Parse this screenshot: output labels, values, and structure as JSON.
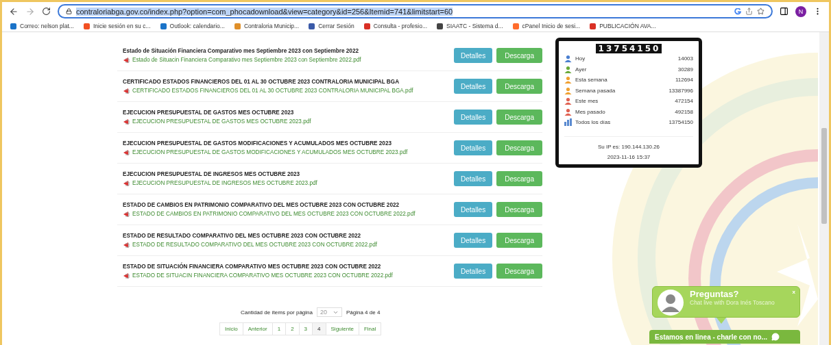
{
  "browser": {
    "url": "contraloriabga.gov.co/index.php?option=com_phocadownload&view=category&id=256&Itemid=741&limitstart=60",
    "profile_initial": "N"
  },
  "bookmarks": [
    {
      "label": "Correo: nelson plat...",
      "color": "#1a73c8"
    },
    {
      "label": "Inicie sesión en su c...",
      "color": "#f25022"
    },
    {
      "label": "Outlook: calendario...",
      "color": "#1a73c8"
    },
    {
      "label": "Contraloria Municip...",
      "color": "#e0902a"
    },
    {
      "label": "Cerrar Sesión",
      "color": "#3a5aa8"
    },
    {
      "label": "Consulta - profesio...",
      "color": "#d93025"
    },
    {
      "label": "SIAATC - Sistema d...",
      "color": "#444444"
    },
    {
      "label": "cPanel Inicio de sesi...",
      "color": "#ff6c2c"
    },
    {
      "label": "PUBLICACIÓN AVA...",
      "color": "#d93025"
    }
  ],
  "documents": [
    {
      "title": "Estado de Situación Financiera Comparativo mes Septiembre 2023 con Septiembre 2022",
      "file": "Estado de Situacin Financiera Comparativo mes Septiembre 2023 con Septiembre 2022.pdf",
      "details": "Detalles",
      "download": "Descarga"
    },
    {
      "title": "CERTIFICADO ESTADOS FINANCIEROS DEL 01 AL 30 OCTUBRE 2023 CONTRALORIA MUNICIPAL BGA",
      "file": "CERTIFICADO ESTADOS FINANCIEROS DEL 01 AL 30 OCTUBRE 2023 CONTRALORIA MUNICIPAL BGA.pdf",
      "details": "Detalles",
      "download": "Descarga"
    },
    {
      "title": "EJECUCION PRESUPUESTAL DE GASTOS MES OCTUBRE 2023",
      "file": "EJECUCION PRESUPUESTAL DE GASTOS MES OCTUBRE 2023.pdf",
      "details": "Detalles",
      "download": "Descarga"
    },
    {
      "title": "EJECUCION PRESUPUESTAL DE GASTOS MODIFICACIONES Y ACUMULADOS MES OCTUBRE 2023",
      "file": "EJECUCION PRESUPUESTAL DE GASTOS MODIFICACIONES Y ACUMULADOS MES OCTUBRE 2023.pdf",
      "details": "Detalles",
      "download": "Descarga"
    },
    {
      "title": "EJECUCION PRESUPUESTAL DE INGRESOS MES OCTUBRE 2023",
      "file": "EJECUCION PRESUPUESTAL DE INGRESOS MES OCTUBRE 2023.pdf",
      "details": "Detalles",
      "download": "Descarga"
    },
    {
      "title": "ESTADO DE CAMBIOS EN PATRIMONIO COMPARATIVO DEL MES OCTUBRE 2023 CON OCTUBRE 2022",
      "file": "ESTADO DE CAMBIOS EN PATRIMONIO COMPARATIVO DEL MES OCTUBRE 2023 CON OCTUBRE 2022.pdf",
      "details": "Detalles",
      "download": "Descarga"
    },
    {
      "title": "ESTADO DE RESULTADO COMPARATIVO DEL MES OCTUBRE 2023 CON OCTUBRE 2022",
      "file": "ESTADO DE RESULTADO COMPARATIVO DEL MES OCTUBRE 2023 CON OCTUBRE 2022.pdf",
      "details": "Detalles",
      "download": "Descarga"
    },
    {
      "title": "ESTADO DE SITUACIÓN FINANCIERA COMPARATIVO MES OCTUBRE 2023 CON OCTUBRE 2022",
      "file": "ESTADO DE SITUACIN FINANCIERA COMPARATIVO MES OCTUBRE 2023 CON OCTUBRE 2022.pdf",
      "details": "Detalles",
      "download": "Descarga"
    }
  ],
  "pagination": {
    "items_label": "Cantidad de ítems por página",
    "items_value": "20",
    "page_info": "Página 4 de 4",
    "links": [
      {
        "label": "Inicio",
        "selected": false
      },
      {
        "label": "Anterior",
        "selected": false
      },
      {
        "label": "1",
        "selected": false
      },
      {
        "label": "2",
        "selected": false
      },
      {
        "label": "3",
        "selected": false
      },
      {
        "label": "4",
        "selected": true
      },
      {
        "label": "Siguiente",
        "selected": false
      },
      {
        "label": "Final",
        "selected": false
      }
    ]
  },
  "visitor_counter": {
    "total": "13754150",
    "rows": [
      {
        "label": "Hoy",
        "value": "14003",
        "kind": "person",
        "color": "#4a7fd0"
      },
      {
        "label": "Ayer",
        "value": "30289",
        "kind": "person",
        "color": "#6aaa3a"
      },
      {
        "label": "Esta semana",
        "value": "112694",
        "kind": "person",
        "color": "#f0a030"
      },
      {
        "label": "Semana pasada",
        "value": "13387996",
        "kind": "person",
        "color": "#f0a030"
      },
      {
        "label": "Este mes",
        "value": "472154",
        "kind": "person",
        "color": "#e06050"
      },
      {
        "label": "Mes pasado",
        "value": "492158",
        "kind": "person",
        "color": "#e06050"
      },
      {
        "label": "Todos los días",
        "value": "13754150",
        "kind": "chart",
        "color": "#5a8ad0"
      }
    ],
    "ip": "Su IP es: 190.144.130.26",
    "datetime": "2023-11-16 15:37"
  },
  "chat": {
    "title": "Preguntas?",
    "subtitle": "Chat live with Dora Inés Toscano",
    "close": "x",
    "bar": "Estamos en linea - charle con no..."
  }
}
